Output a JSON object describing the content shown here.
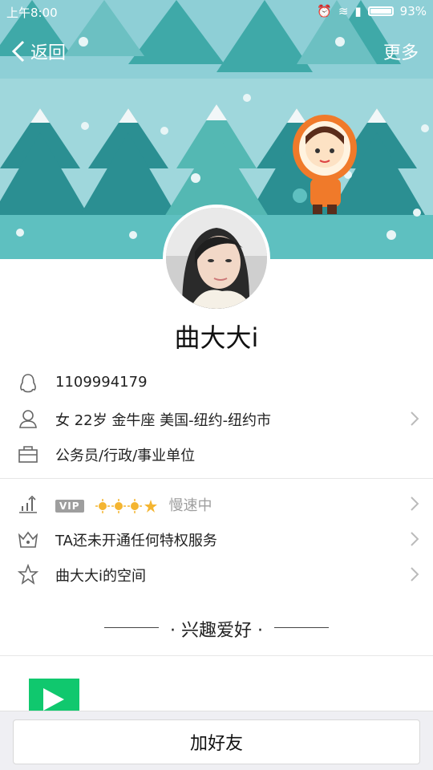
{
  "status_bar": {
    "time": "上午8:00",
    "battery": "93%"
  },
  "topbar": {
    "back_label": "返回",
    "more_label": "更多"
  },
  "profile": {
    "name": "曲大大i",
    "qq_number": "1109994179",
    "info": "女  22岁  金牛座  美国-纽约-纽约市",
    "occupation": "公务员/行政/事业单位"
  },
  "vip": {
    "badge": "VIP",
    "level_icons": [
      "sun-icon",
      "sun-icon",
      "sun-icon",
      "star-icon"
    ],
    "speed": "慢速中"
  },
  "privilege": {
    "label": "TA还未开通任何特权服务"
  },
  "space": {
    "label": "曲大大i的空间"
  },
  "interests": {
    "title": "兴趣爱好"
  },
  "bottom": {
    "add_friend_label": "加好友"
  },
  "colors": {
    "banner_sky": "#96d3d9",
    "tree_dark": "#2b8f92",
    "tree_mid": "#3fa9a8",
    "snow": "#f2f7f8"
  }
}
